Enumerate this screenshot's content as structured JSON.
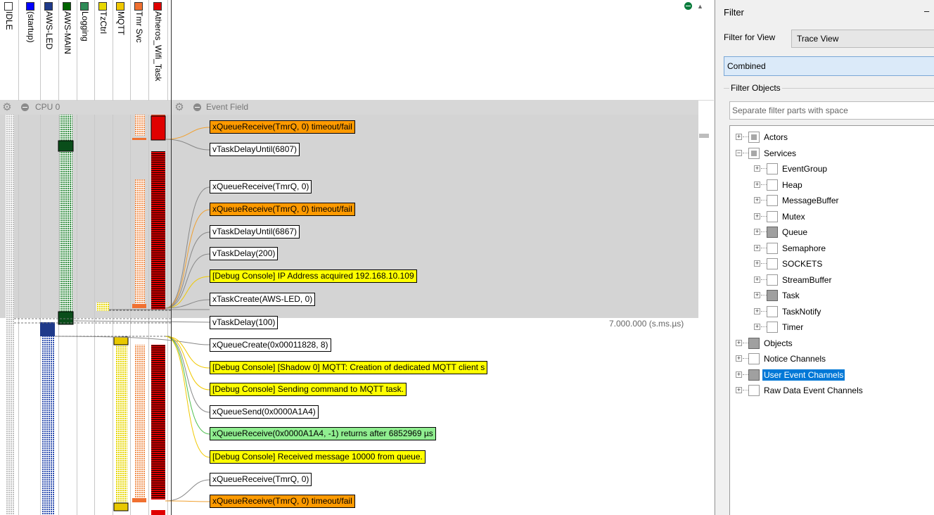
{
  "trace": {
    "columns": [
      {
        "label": "IDLE",
        "color": "#ffffff"
      },
      {
        "label": "(startup)",
        "color": "#0000ff"
      },
      {
        "label": "AWS-LED",
        "color": "#1f3a8a"
      },
      {
        "label": "AWS-MAIN",
        "color": "#006400"
      },
      {
        "label": "Logging",
        "color": "#2e8b57"
      },
      {
        "label": "TzCtrl",
        "color": "#e8d800"
      },
      {
        "label": "MQTT",
        "color": "#f0c800"
      },
      {
        "label": "Tmr Svc",
        "color": "#f07030"
      },
      {
        "label": "Atheros_Wifi_Task",
        "color": "#e00000"
      }
    ],
    "cpu_label": "CPU 0",
    "event_field_label": "Event Field",
    "timestamp": "7.000.000 (s.ms.µs)",
    "events": [
      {
        "text": "xQueueReceive(TmrQ, 0) timeout/fail",
        "style": "orange"
      },
      {
        "text": "vTaskDelayUntil(6807)",
        "style": "white"
      },
      {
        "text": "xQueueReceive(TmrQ, 0)",
        "style": "white"
      },
      {
        "text": "xQueueReceive(TmrQ, 0) timeout/fail",
        "style": "orange"
      },
      {
        "text": "vTaskDelayUntil(6867)",
        "style": "white"
      },
      {
        "text": "vTaskDelay(200)",
        "style": "white"
      },
      {
        "text": "[Debug Console] IP Address acquired 192.168.10.109",
        "style": "yellow"
      },
      {
        "text": "xTaskCreate(AWS-LED, 0)",
        "style": "white"
      },
      {
        "text": "vTaskDelay(100)",
        "style": "white"
      },
      {
        "text": "xQueueCreate(0x00011828, 8)",
        "style": "white"
      },
      {
        "text": "[Debug Console] [Shadow 0] MQTT: Creation of dedicated MQTT client s",
        "style": "yellow"
      },
      {
        "text": "[Debug Console] Sending command to MQTT task.",
        "style": "yellow"
      },
      {
        "text": "xQueueSend(0x0000A1A4)",
        "style": "white"
      },
      {
        "text": "xQueueReceive(0x0000A1A4, -1) returns after 6852969 µs",
        "style": "green"
      },
      {
        "text": "[Debug Console] Received message 10000 from queue.",
        "style": "yellow"
      },
      {
        "text": "xQueueReceive(TmrQ, 0)",
        "style": "white"
      },
      {
        "text": "xQueueReceive(TmrQ, 0) timeout/fail",
        "style": "orange"
      }
    ]
  },
  "filter": {
    "title": "Filter",
    "minimize": "–",
    "filter_for_view_label": "Filter for View",
    "filter_for_view_value": "Trace View",
    "combined": "Combined",
    "filter_objects_label": "Filter Objects",
    "search_placeholder": "Separate filter parts with space",
    "tree": [
      {
        "label": "Actors",
        "level": 0,
        "state": "partial",
        "expander": "+"
      },
      {
        "label": "Services",
        "level": 0,
        "state": "partial",
        "expander": "−"
      },
      {
        "label": "EventGroup",
        "level": 1,
        "state": "empty",
        "expander": "+"
      },
      {
        "label": "Heap",
        "level": 1,
        "state": "empty",
        "expander": "+"
      },
      {
        "label": "MessageBuffer",
        "level": 1,
        "state": "empty",
        "expander": "+"
      },
      {
        "label": "Mutex",
        "level": 1,
        "state": "empty",
        "expander": "+"
      },
      {
        "label": "Queue",
        "level": 1,
        "state": "full",
        "expander": "+"
      },
      {
        "label": "Semaphore",
        "level": 1,
        "state": "empty",
        "expander": "+"
      },
      {
        "label": "SOCKETS",
        "level": 1,
        "state": "empty",
        "expander": "+"
      },
      {
        "label": "StreamBuffer",
        "level": 1,
        "state": "empty",
        "expander": "+"
      },
      {
        "label": "Task",
        "level": 1,
        "state": "full",
        "expander": "+"
      },
      {
        "label": "TaskNotify",
        "level": 1,
        "state": "empty",
        "expander": "+"
      },
      {
        "label": "Timer",
        "level": 1,
        "state": "empty",
        "expander": "+"
      },
      {
        "label": "Objects",
        "level": 0,
        "state": "full",
        "expander": "+"
      },
      {
        "label": "Notice Channels",
        "level": 0,
        "state": "empty",
        "expander": "+"
      },
      {
        "label": "User Event Channels",
        "level": 0,
        "state": "full",
        "expander": "+",
        "selected": true
      },
      {
        "label": "Raw Data Event Channels",
        "level": 0,
        "state": "empty",
        "expander": "+"
      }
    ]
  }
}
